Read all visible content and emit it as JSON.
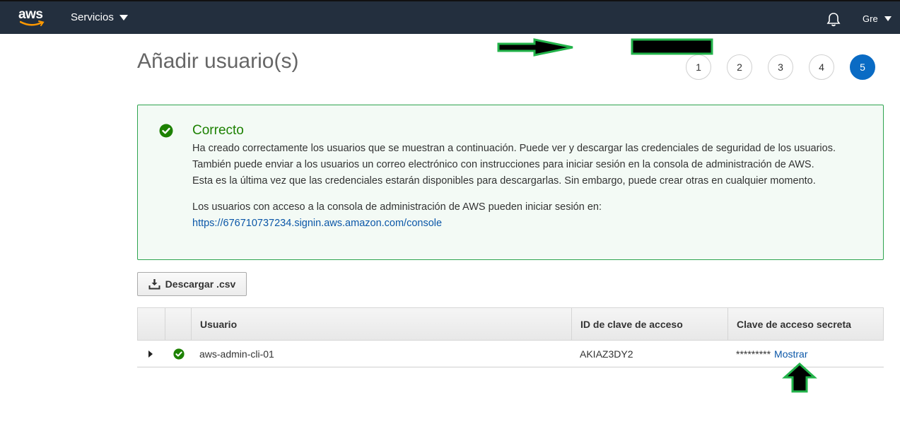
{
  "topbar": {
    "logo_text": "aws",
    "services_label": "Servicios",
    "user_label": "Gre"
  },
  "page": {
    "title": "Añadir usuario(s)"
  },
  "steps": [
    "1",
    "2",
    "3",
    "4",
    "5"
  ],
  "active_step": "5",
  "alert": {
    "title": "Correcto",
    "lines": [
      "Ha creado correctamente los usuarios que se muestran a continuación. Puede ver y descargar las credenciales de seguridad de los usuarios.",
      "También puede enviar a los usuarios un correo electrónico con instrucciones para iniciar sesión en la consola de administración de AWS.",
      "Esta es la última vez que las credenciales estarán disponibles para descargarlas. Sin embargo, puede crear otras en cualquier momento."
    ],
    "access_text": "Los usuarios con acceso a la consola de administración de AWS pueden iniciar sesión en:",
    "console_url": "https://676710737234.signin.aws.amazon.com/console"
  },
  "download_button": "Descargar .csv",
  "table": {
    "headers": [
      "Usuario",
      "ID de clave de acceso",
      "Clave de acceso secreta"
    ],
    "rows": [
      {
        "user": "aws-admin-cli-01",
        "access_key_id": "AKIAZ3DY2",
        "secret_masked": "*********",
        "show_label": "Mostrar"
      }
    ]
  },
  "colors": {
    "topbar": "#232f3e",
    "success": "#1d8102",
    "alert_border": "#2ea44f",
    "alert_bg": "#f3faf5",
    "link": "#0b57a8",
    "active_step": "#0a6bc4",
    "annotation_outline": "#22b34a"
  }
}
